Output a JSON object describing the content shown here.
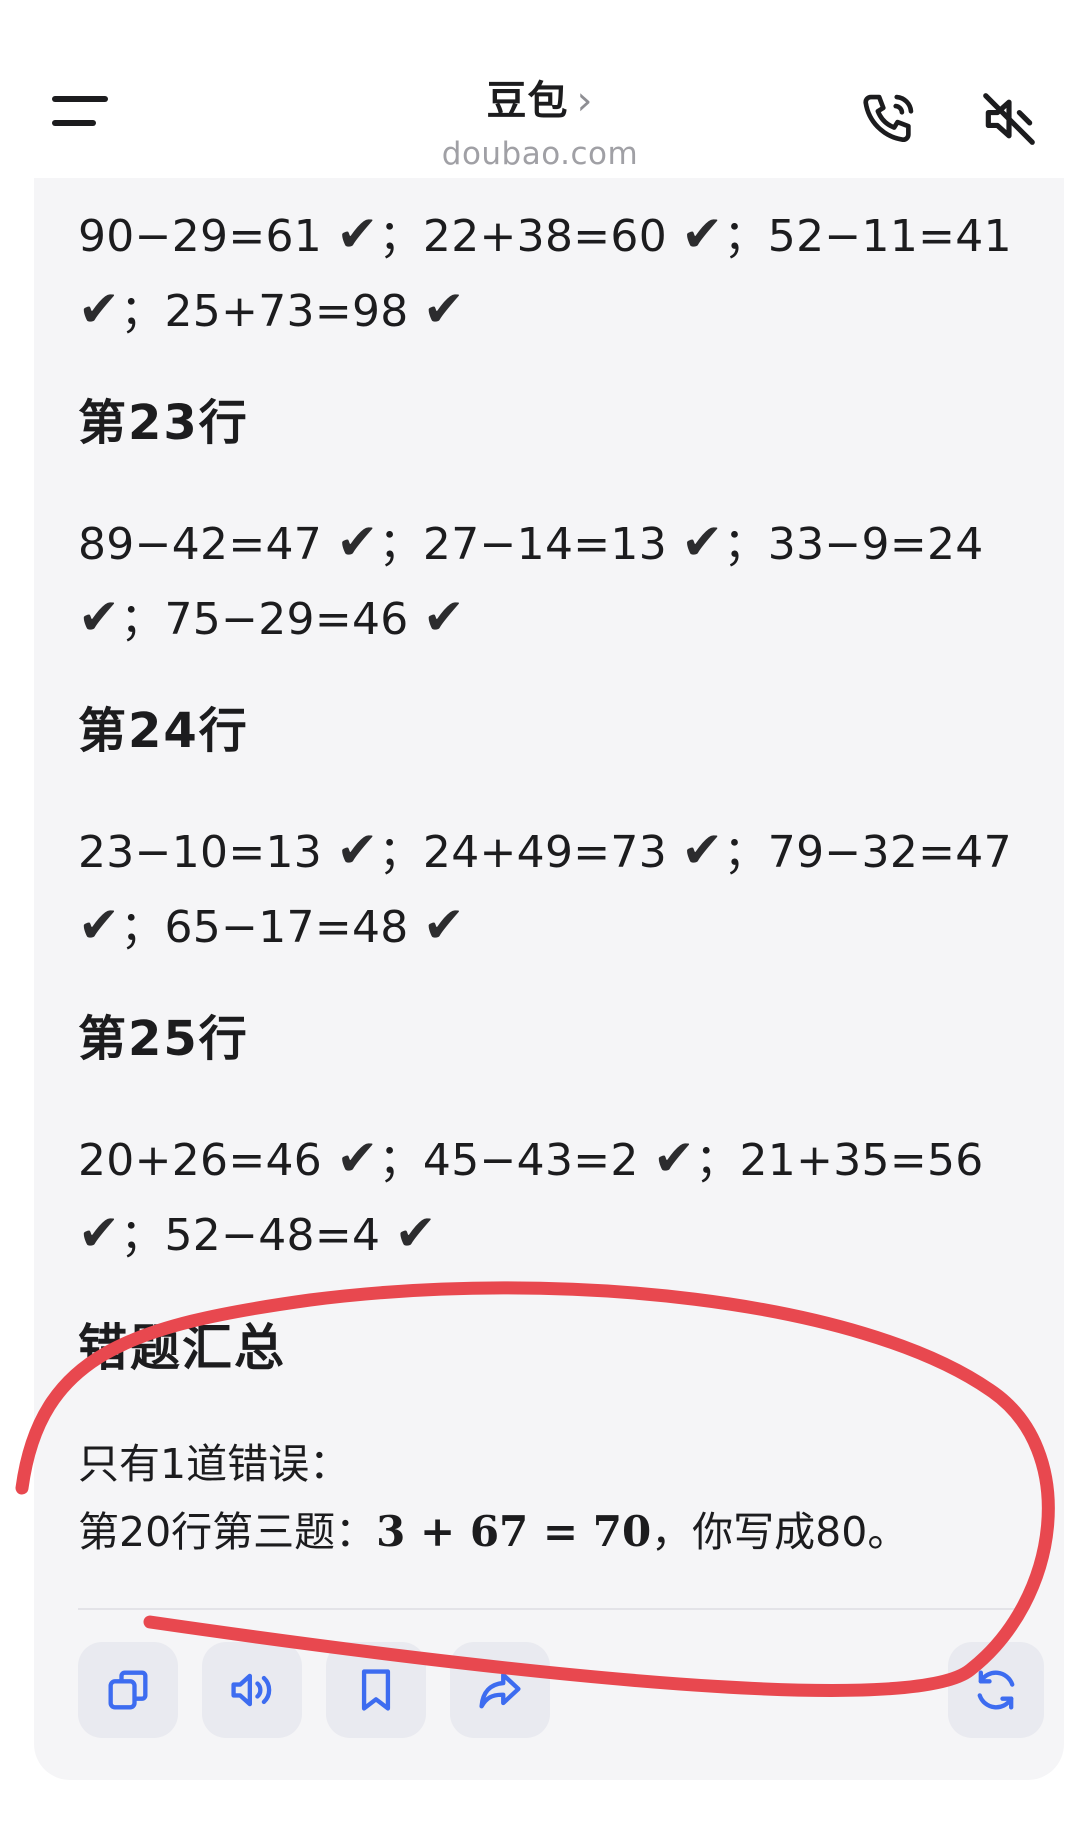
{
  "header": {
    "title": "豆包",
    "chevron": "›",
    "subtitle": "doubao.com",
    "menu_icon": "hamburger-menu-icon",
    "call_icon": "phone-icon",
    "mute_icon": "speaker-mute-icon"
  },
  "chat": {
    "row22_line1": "90−29=61 ",
    "row22_line1b": "；22+38=60 ",
    "row22_line1c": "；52−11=41",
    "row22_line2": "；25+73=98 ",
    "row23_heading": "第23行",
    "row23_line1": "89−42=47 ",
    "row23_line1b": "；27−14=13 ",
    "row23_line1c": "；33−9=24",
    "row23_line2": "；75−29=46 ",
    "row24_heading": "第24行",
    "row24_line1": "23−10=13 ",
    "row24_line1b": "；24+49=73 ",
    "row24_line1c": "；79−32=47",
    "row24_line2": "；65−17=48 ",
    "row25_heading": "第25行",
    "row25_line1": "20+26=46 ",
    "row25_line1b": "；45−43=2 ",
    "row25_line1c": "；21+35=56",
    "row25_line2": "；52−48=4 ",
    "check_mark": "✔",
    "summary_title": "错题汇总",
    "summary_line1": "只有1道错误：",
    "summary_line2_prefix": "第20行第三题：",
    "summary_math": "3 + 67 = 70",
    "summary_line2_suffix": "，你写成80。"
  },
  "actions": {
    "copy_icon": "copy-icon",
    "speak_icon": "speaker-icon",
    "bookmark_icon": "bookmark-icon",
    "share_icon": "share-icon",
    "regenerate_icon": "refresh-icon"
  },
  "colors": {
    "annotation": "#e8484f",
    "icon_blue": "#3d6cf0",
    "action_bg": "#e9eaf0",
    "card_bg": "#f5f5f7"
  }
}
